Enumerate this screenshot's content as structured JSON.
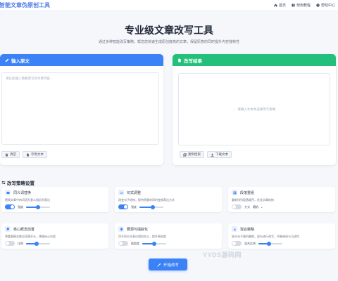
{
  "nav": {
    "brand": "智能文章伪原创工具",
    "links": [
      {
        "label": "首页",
        "icon": "home-icon"
      },
      {
        "label": "使用教程",
        "icon": "book-icon"
      },
      {
        "label": "帮助中心",
        "icon": "help-icon"
      }
    ]
  },
  "hero": {
    "title": "专业级文章改写工具",
    "subtitle": "通过多种智能改写策略，帮您您快速生成原创度高的文章，保留原意的同时提升内容独特性"
  },
  "input_panel": {
    "title": "输入原文",
    "placeholder": "请在此输入需要改写的文章内容...",
    "clear_label": "清空",
    "example_label": "示例文本"
  },
  "output_panel": {
    "title": "改写结果",
    "empty_hint": "请输入文本并选择改写策略",
    "copy_label": "复制结果",
    "download_label": "下载文本"
  },
  "strategy": {
    "section_title": "改写策略设置",
    "cards": [
      {
        "title": "同义词替换",
        "desc": "替换文章中的词语为意义相近的表达",
        "toggle": true,
        "ctrl_label": "强度",
        "slider": 0.5,
        "icon": "synonym-icon"
      },
      {
        "title": "句式调整",
        "desc": "改变句子结构，保持原意的同时变换表达方式",
        "toggle": true,
        "ctrl_label": "强度",
        "slider": 0.55,
        "icon": "shuffle-icon"
      },
      {
        "title": "段落重组",
        "desc": "重新排列段落顺序，优化文章结构",
        "toggle": false,
        "ctrl_label": "方式",
        "select_value": "随机",
        "icon": "grid-icon"
      },
      {
        "title": "核心概念前置",
        "desc": "将重要概念移至段落开头，增强核心内容",
        "toggle": false,
        "ctrl_label": "比例",
        "slider": 0.45,
        "icon": "flag-icon"
      },
      {
        "title": "要源与插叙化",
        "desc": "用不同方式表达相同含义，提升原创度",
        "toggle": false,
        "ctrl_label": "插叙度",
        "slider": 0.5,
        "icon": "bulb-icon"
      },
      {
        "title": "混合策略",
        "desc": "部分句子随机替换，部分进行改写，平衡原创与可读性",
        "toggle": false,
        "ctrl_label": "混合比例",
        "slider": 0.45,
        "icon": "mix-icon"
      }
    ],
    "start_label": "开始改写"
  },
  "watermark": "YYDS源码网",
  "colors": {
    "primary": "#3b82f6",
    "success": "#22c07a",
    "brand": "#4f7de8"
  }
}
